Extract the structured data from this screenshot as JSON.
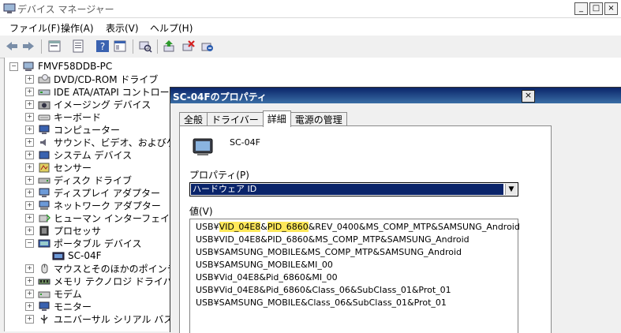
{
  "window": {
    "title": "デバイス マネージャー",
    "buttons": [
      "_",
      "□",
      "×"
    ]
  },
  "menu": [
    "ファイル(F)",
    "操作(A)",
    "表示(V)",
    "ヘルプ(H)"
  ],
  "tree": {
    "root": "FMVF58DDB-PC",
    "items": [
      "DVD/CD-ROM ドライブ",
      "IDE ATA/ATAPI コントローラー",
      "イメージング デバイス",
      "キーボード",
      "コンピューター",
      "サウンド、ビデオ、およびゲーム コ",
      "システム デバイス",
      "センサー",
      "ディスク ドライブ",
      "ディスプレイ アダプター",
      "ネットワーク アダプター",
      "ヒューマン インターフェイス デバイ",
      "プロセッサ",
      "ポータブル デバイス",
      "SC-04F",
      "マウスとそのほかのポインティング",
      "メモリ テクノロジ ドライバー",
      "モデム",
      "モニター",
      "ユニバーサル シリアル バス コント"
    ]
  },
  "dialog": {
    "title": "SC-04Fのプロパティ",
    "close": "×",
    "tabs": [
      "全般",
      "ドライバー",
      "詳細",
      "電源の管理"
    ],
    "device_name": "SC-04F",
    "property_label": "プロパティ(P)",
    "property_value": "ハードウェア ID",
    "value_label": "値(V)",
    "values": {
      "row0": {
        "pre": "USB¥",
        "hl1": "VID_04E8",
        "mid": "&",
        "hl2": "PID_6860",
        "post": "&REV_0400&MS_COMP_MTP&SAMSUNG_Android"
      },
      "rows": [
        "USB¥VID_04E8&PID_6860&MS_COMP_MTP&SAMSUNG_Android",
        "USB¥SAMSUNG_MOBILE&MS_COMP_MTP&SAMSUNG_Android",
        "USB¥SAMSUNG_MOBILE&MI_00",
        "USB¥Vid_04E8&Pid_6860&MI_00",
        "USB¥Vid_04E8&Pid_6860&Class_06&SubClass_01&Prot_01",
        "USB¥SAMSUNG_MOBILE&Class_06&SubClass_01&Prot_01"
      ]
    }
  },
  "colors": {
    "selection": "#0a246a",
    "highlight": "#ffe85a",
    "titlebar": "#0a246a"
  }
}
